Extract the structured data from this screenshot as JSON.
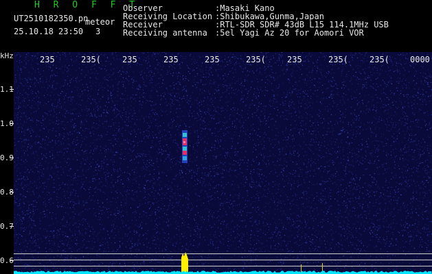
{
  "header": {
    "app_name": "H R O F F T",
    "filename": "UT2510182350.pn",
    "mode": "meteor",
    "datetime": "25.10.18 23:50",
    "count": "3",
    "labels": {
      "observer": "Observer",
      "location": "Receiving Location",
      "receiver": "Receiver",
      "antenna": "Receiving antenna"
    },
    "values": {
      "observer": ":Masaki Kano",
      "location": ":Shibukawa,Gunma,Japan",
      "receiver": ":RTL-SDR SDR# 43dB L15 114.1MHz USB",
      "antenna": ":5el Yagi Az 20 for Aomori VOR"
    }
  },
  "axis": {
    "y_unit": "kHz",
    "y_ticks": [
      "1.1",
      "1.0",
      "0.9",
      "0.8",
      "0.7",
      "0.6"
    ],
    "x_ticks": [
      "235",
      "235(",
      "235",
      "235",
      "235",
      "235(",
      "235",
      "235(",
      "235(",
      "0000"
    ]
  },
  "colors": {
    "background": "#0a0a3a",
    "noise": "#2a3aa8",
    "echo_hot": "#e0306a",
    "echo_cool": "#30c0d8",
    "baseline": "#00e5ff",
    "burst": "#ffee00"
  }
}
